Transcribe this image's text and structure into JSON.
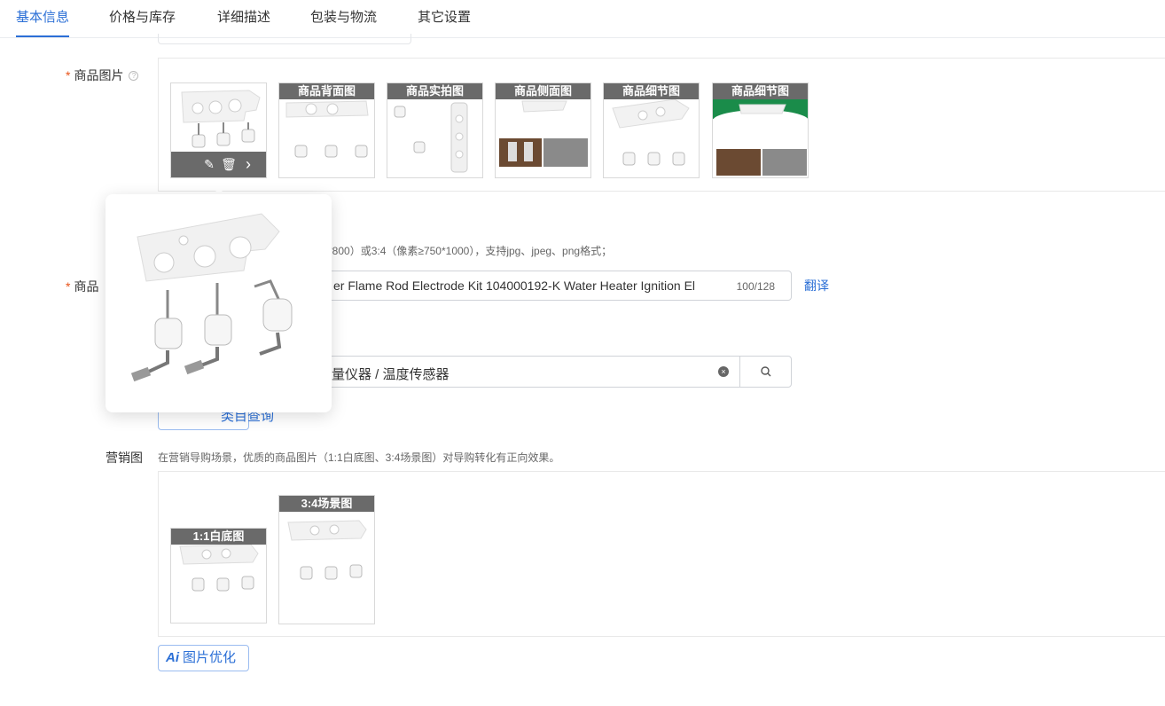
{
  "tabs": [
    "基本信息",
    "价格与库存",
    "详细描述",
    "包装与物流",
    "其它设置"
  ],
  "images": {
    "label": "商品图片",
    "required_mark": "*",
    "help_icon": "?",
    "captions": [
      "商品背面图",
      "商品实拍图",
      "商品侧面图",
      "商品细节图",
      "商品细节图"
    ],
    "toolbar": {
      "edit_icon": "✎",
      "delete_icon": "🗑",
      "next_icon": "›"
    },
    "hint": "*800）或3:4（像素≥750*1000），支持jpg、jpeg、png格式；"
  },
  "title_field": {
    "label_partial": "商品",
    "required_mark": "*",
    "value": "er Flame Rod Electrode Kit 104000192-K Water Heater Ignition El",
    "count": "100/128",
    "translate_link": "翻译"
  },
  "category": {
    "value": "量仪器 / 温度传感器",
    "clear_icon": "×",
    "search_icon": "search-icon",
    "ai_button_partial": "类目查询"
  },
  "marketing": {
    "label": "营销图",
    "hint": "在营销导购场景，优质的商品图片（1:1白底图、3:4场景图）对导购转化有正向效果。",
    "captions": [
      "1:1白底图",
      "3:4场景图"
    ],
    "ai_badge": "Ai",
    "optimize_button": "图片优化"
  },
  "colors": {
    "accent": "#2b6fd6",
    "required": "#e8541a",
    "caption_bg": "#6a6a6a",
    "green_banner": "#1a8c4a"
  }
}
